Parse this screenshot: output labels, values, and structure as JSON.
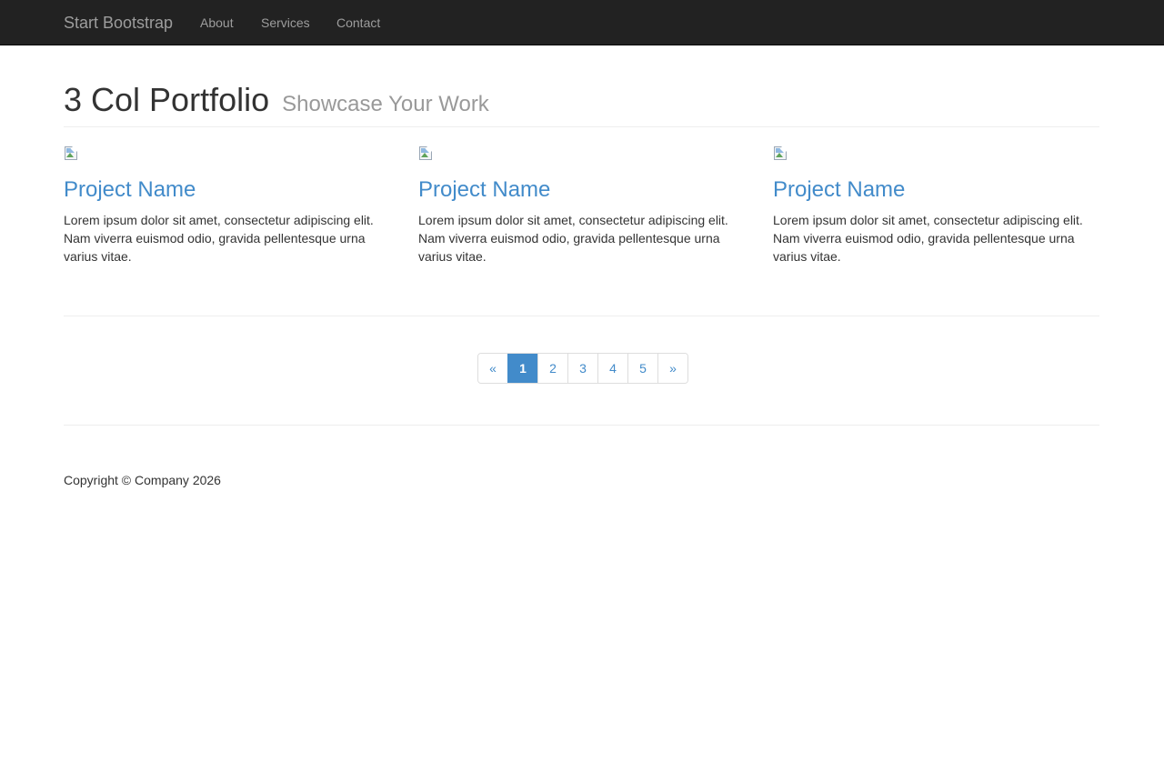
{
  "navbar": {
    "brand": "Start Bootstrap",
    "links": [
      "About",
      "Services",
      "Contact"
    ]
  },
  "header": {
    "title": "3 Col Portfolio",
    "subtitle": "Showcase Your Work"
  },
  "projects": [
    {
      "title": "Project Name",
      "description": "Lorem ipsum dolor sit amet, consectetur adipiscing elit. Nam viverra euismod odio, gravida pellentesque urna varius vitae."
    },
    {
      "title": "Project Name",
      "description": "Lorem ipsum dolor sit amet, consectetur adipiscing elit. Nam viverra euismod odio, gravida pellentesque urna varius vitae."
    },
    {
      "title": "Project Name",
      "description": "Lorem ipsum dolor sit amet, consectetur adipiscing elit. Nam viverra euismod odio, gravida pellentesque urna varius vitae."
    }
  ],
  "pagination": {
    "prev": "«",
    "pages": [
      "1",
      "2",
      "3",
      "4",
      "5"
    ],
    "active": "1",
    "next": "»"
  },
  "footer": {
    "copyright": "Copyright © Company 2026"
  },
  "colors": {
    "navbar_bg": "#222222",
    "link": "#428bca",
    "active_page_bg": "#428bca"
  },
  "icons": {
    "project_image": "broken-image-icon"
  }
}
